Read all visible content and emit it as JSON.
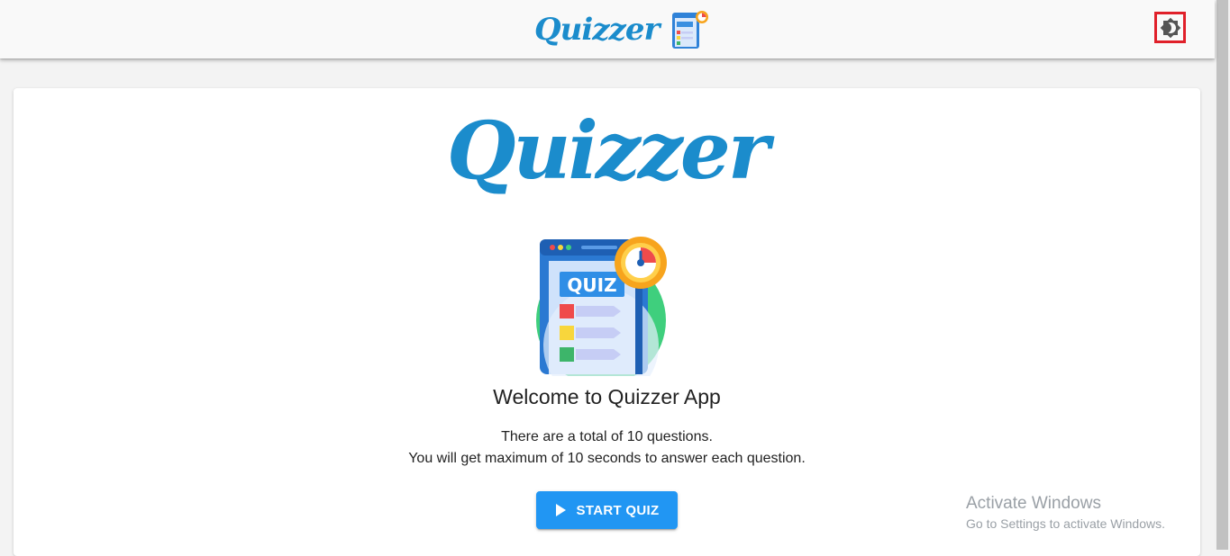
{
  "header": {
    "brand": "Quizzer",
    "logo_icon": "quiz-app-icon",
    "theme_toggle_icon": "brightness-toggle-icon"
  },
  "main": {
    "hero_title": "Quizzer",
    "hero_icon": "quiz-app-icon",
    "welcome": "Welcome to Quizzer App",
    "info_line_1": "There are a total of 10 questions.",
    "info_line_2": "You will get maximum of 10 seconds to answer each question.",
    "start_button": "START QUIZ",
    "start_icon": "play-icon"
  },
  "watermark": {
    "title": "Activate Windows",
    "subtitle": "Go to Settings to activate Windows."
  },
  "colors": {
    "brand": "#1b8ccc",
    "primary": "#2196f3",
    "highlight_border": "#e0202a"
  }
}
